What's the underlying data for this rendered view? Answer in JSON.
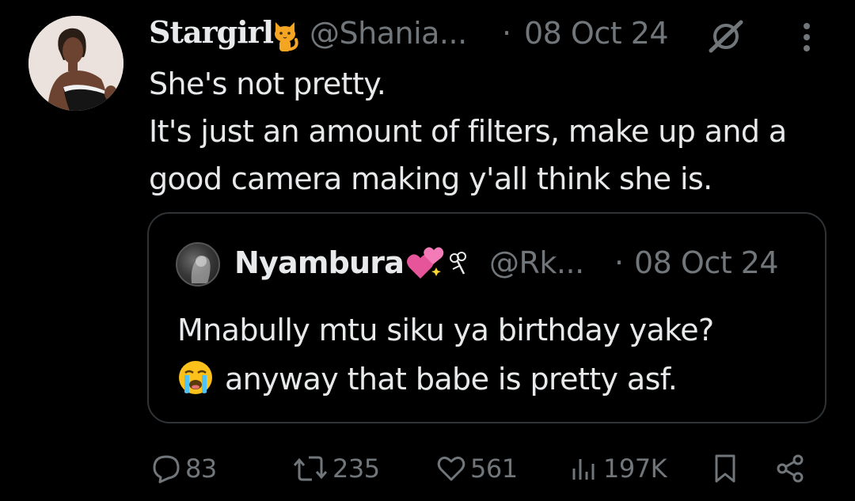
{
  "tweet": {
    "display_name": "Stargirl",
    "name_emoji": "cat-emoji",
    "handle": "@Shania...",
    "separator": "·",
    "date": "08 Oct 24",
    "text": "She's not pretty.\nIt's just an amount of filters, make up and a good camera making y'all think she is.",
    "grok_icon": "grok-icon",
    "more_icon": "more-options-icon"
  },
  "quoted": {
    "display_name": "Nyambura",
    "name_emoji": "sparkling-hearts-emoji",
    "name_icon": "flower-icon",
    "handle": "@Rk...",
    "separator": "·",
    "date": "08 Oct 24",
    "line1": "Mnabully mtu siku ya birthday yake?",
    "line2": "anyway that babe is pretty asf.",
    "line2_emoji": "loudly-crying-face-emoji"
  },
  "actions": {
    "replies": "83",
    "retweets": "235",
    "likes": "561",
    "views": "197K"
  },
  "colors": {
    "background": "#000000",
    "text": "#e7e9ea",
    "muted": "#71767b",
    "border": "#2f3336"
  }
}
